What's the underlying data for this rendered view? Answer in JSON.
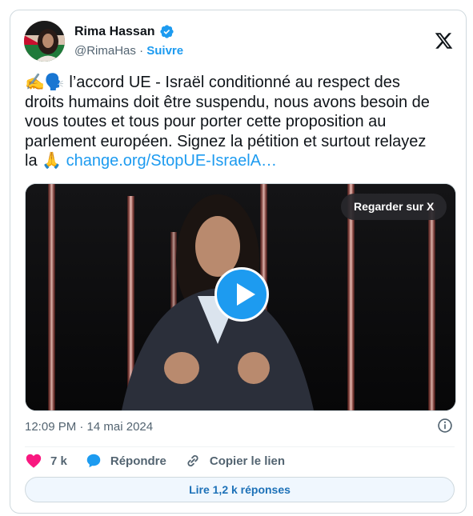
{
  "author": {
    "name": "Rima Hassan",
    "handle": "@RimaHas",
    "separator": "·",
    "follow_label": "Suivre"
  },
  "tweet": {
    "emoji_prefix": "✍️🗣️",
    "text": " l’accord UE - Israël conditionné au respect des droits humains doit être suspendu, nous avons besoin de vous toutes et tous pour porter cette proposition au parlement européen. Signez la pétition et surtout relayez la ",
    "emoji_suffix": "🙏",
    "link": "change.org/StopUE-IsraelA…"
  },
  "media": {
    "watch_label": "Regarder sur X",
    "type": "video"
  },
  "timestamp": "12:09 PM · 14 mai 2024",
  "actions": {
    "likes": "7 k",
    "reply_label": "Répondre",
    "copy_label": "Copier le lien"
  },
  "replies_button": "Lire 1,2 k réponses",
  "colors": {
    "accent": "#1d9bf0",
    "like": "#f91880",
    "text": "#0f1419",
    "muted": "#536471"
  }
}
